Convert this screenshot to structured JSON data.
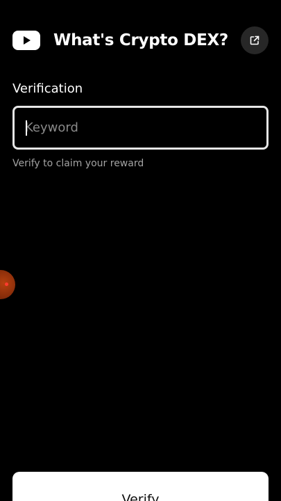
{
  "header": {
    "logo_icon": "youtube-logo-icon",
    "title": "What's Crypto DEX?",
    "share_icon": "external-link-icon"
  },
  "form": {
    "label": "Verification",
    "input_placeholder": "Keyword",
    "input_value": "",
    "helper_text": "Verify to claim your reward",
    "submit_label": "Verify"
  },
  "overlay": {
    "bubble_icon": "floating-assistant-bubble-icon"
  },
  "colors": {
    "background": "#000000",
    "text": "#ffffff",
    "muted_text": "#a3a3a3",
    "input_border": "#e6e6e6",
    "share_button_bg": "#272727",
    "button_bg": "#ffffff",
    "button_text": "#0f0f0f",
    "bubble": "#8a2e0a"
  }
}
